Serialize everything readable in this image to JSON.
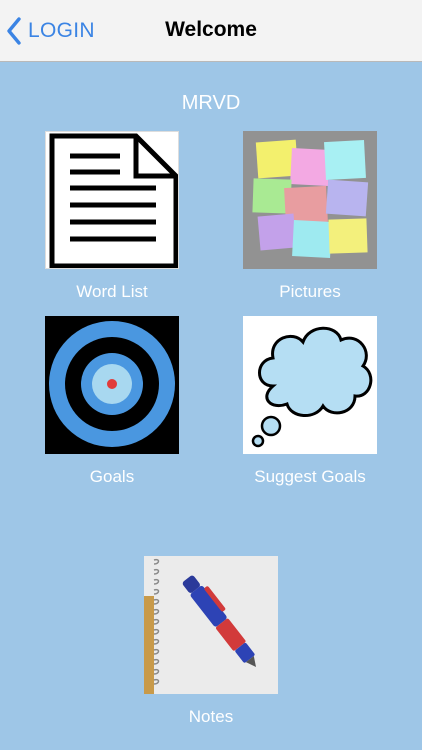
{
  "nav": {
    "back_label": "LOGIN",
    "title": "Welcome",
    "accent": "#3b84e4"
  },
  "user": {
    "name": "MRVD"
  },
  "tiles": [
    {
      "label": "Word List",
      "icon": "document-icon"
    },
    {
      "label": "Pictures",
      "icon": "sticky-notes-icon"
    },
    {
      "label": "Goals",
      "icon": "target-icon"
    },
    {
      "label": "Suggest Goals",
      "icon": "thought-cloud-icon"
    },
    {
      "label": "Notes",
      "icon": "notebook-pen-icon"
    }
  ],
  "colors": {
    "background": "#9ec6e7",
    "navbar": "#f3f3f3"
  }
}
